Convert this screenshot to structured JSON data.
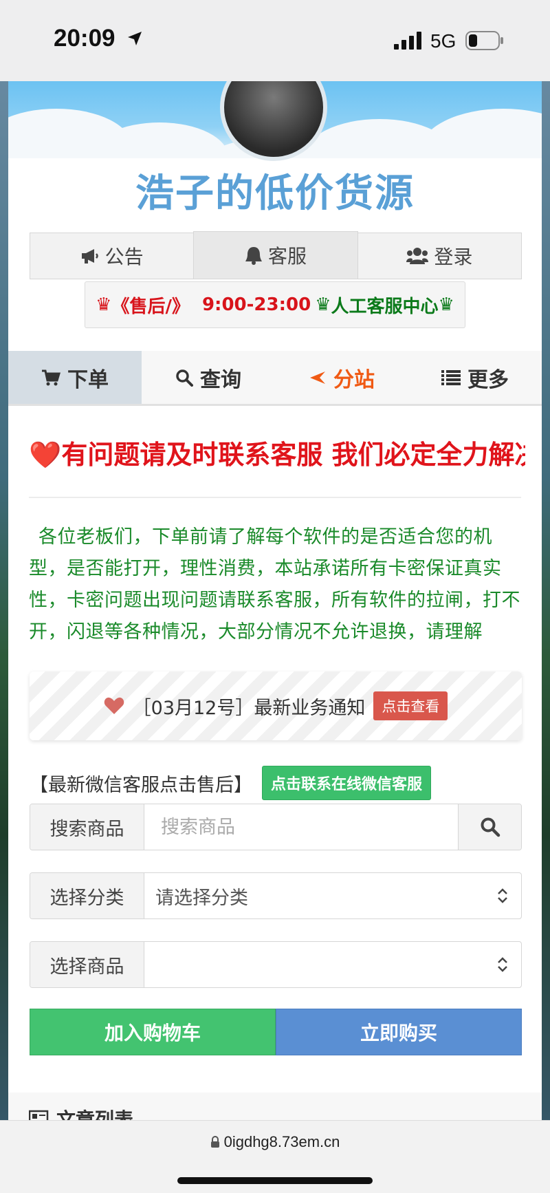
{
  "status_bar": {
    "time": "20:09",
    "network": "5G"
  },
  "site": {
    "title": "浩子的低价货源"
  },
  "top_buttons": [
    {
      "label": "公告",
      "icon": "megaphone-icon"
    },
    {
      "label": "客服",
      "icon": "support-icon"
    },
    {
      "label": "登录",
      "icon": "users-icon"
    }
  ],
  "hours_notice": {
    "crown": "♛",
    "after_sales": "《售后/》",
    "hours": "9:00-23:00",
    "center": "人工客服中心"
  },
  "nav_tabs": [
    {
      "label": "下单",
      "icon": "cart-icon",
      "active": true
    },
    {
      "label": "查询",
      "icon": "search-icon",
      "active": false
    },
    {
      "label": "分站",
      "icon": "arrow-icon",
      "active": false
    },
    {
      "label": "更多",
      "icon": "list-icon",
      "active": false
    }
  ],
  "alert": {
    "emoji": "❤️",
    "text": "有问题请及时联系客服 我们必定全力解决"
  },
  "notice_paragraph": "各位老板们，下单前请了解每个软件的是否适合您的机型，是否能打开，理性消费，本站承诺所有卡密保证真实性，卡密问题出现问题请联系客服，所有软件的拉闸，打不开，闪退等各种情况，大部分情况不允许退换，请理解",
  "business_notice": {
    "text": "［03月12号］最新业务通知",
    "button": "点击查看"
  },
  "wechat": {
    "text": "【最新微信客服点击售后】",
    "button": "点击联系在线微信客服"
  },
  "form": {
    "search_label": "搜索商品",
    "search_placeholder": "搜索商品",
    "category_label": "选择分类",
    "category_value": "请选择分类",
    "product_label": "选择商品",
    "product_value": ""
  },
  "actions": {
    "add_to_cart": "加入购物车",
    "buy_now": "立即购买"
  },
  "article_list": {
    "title": "文章列表"
  },
  "browser": {
    "url": "0igdhg8.73em.cn"
  },
  "colors": {
    "title_blue": "#5aa0d6",
    "alert_red": "#e0141b",
    "notice_green": "#1a8a2a",
    "branch_orange": "#f05a14",
    "cart_green": "#43c370",
    "buy_blue": "#5a8fd3"
  }
}
